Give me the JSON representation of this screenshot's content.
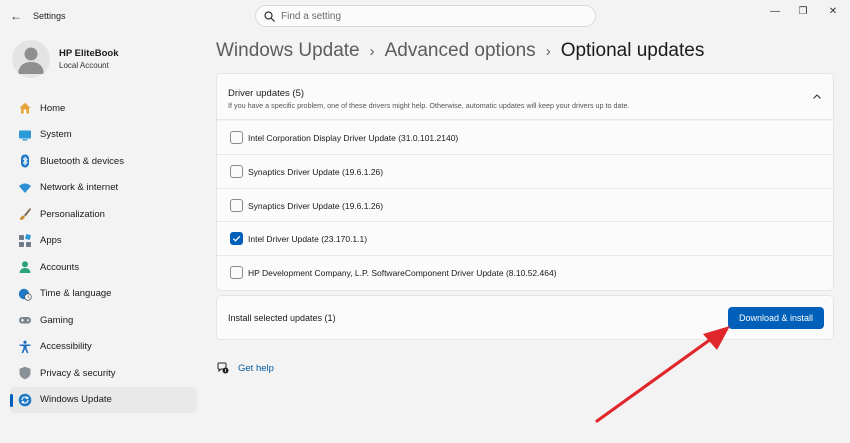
{
  "window": {
    "title": "Settings",
    "back_glyph": "←",
    "controls": [
      "—",
      "❐",
      "✕"
    ]
  },
  "search": {
    "placeholder": "Find a setting",
    "value": ""
  },
  "profile": {
    "name": "HP EliteBook",
    "account": "Local Account"
  },
  "nav": {
    "items": [
      {
        "label": "Home",
        "icon": "home-icon",
        "color": "#e8a33d"
      },
      {
        "label": "System",
        "icon": "system-icon",
        "color": "#2b9ad8"
      },
      {
        "label": "Bluetooth & devices",
        "icon": "bluetooth-icon",
        "color": "#1f79c7"
      },
      {
        "label": "Network & internet",
        "icon": "wifi-icon",
        "color": "#2f8fd6"
      },
      {
        "label": "Personalization",
        "icon": "brush-icon",
        "color": "#c98a35"
      },
      {
        "label": "Apps",
        "icon": "apps-icon",
        "color": "#6d7a85"
      },
      {
        "label": "Accounts",
        "icon": "accounts-icon",
        "color": "#2aa37a"
      },
      {
        "label": "Time & language",
        "icon": "globe-clock-icon",
        "color": "#1f79c7"
      },
      {
        "label": "Gaming",
        "icon": "gamepad-icon",
        "color": "#7b8790"
      },
      {
        "label": "Accessibility",
        "icon": "accessibility-icon",
        "color": "#1f6fc0"
      },
      {
        "label": "Privacy & security",
        "icon": "shield-icon",
        "color": "#8a9198"
      },
      {
        "label": "Windows Update",
        "icon": "sync-icon",
        "color": "#1f79c7",
        "active": true
      }
    ]
  },
  "breadcrumb": {
    "items": [
      "Windows Update",
      "Advanced options",
      "Optional updates"
    ],
    "separator": "›"
  },
  "drivers": {
    "title": "Driver updates (5)",
    "subtitle": "If you have a specific problem, one of these drivers might help. Otherwise, automatic updates will keep your drivers up to date.",
    "expanded": true,
    "items": [
      {
        "label": "Intel Corporation Display Driver Update (31.0.101.2140)",
        "checked": false
      },
      {
        "label": "Synaptics Driver Update (19.6.1.26)",
        "checked": false
      },
      {
        "label": "Synaptics Driver Update (19.6.1.26)",
        "checked": false
      },
      {
        "label": "Intel Driver Update (23.170.1.1)",
        "checked": true
      },
      {
        "label": "HP Development Company, L.P. SoftwareComponent Driver Update (8.10.52.464)",
        "checked": false
      }
    ]
  },
  "install": {
    "label": "Install selected updates (1)",
    "button": "Download & install"
  },
  "help": {
    "label": "Get help",
    "icon": "help-icon"
  },
  "colors": {
    "accent": "#005fb8",
    "annotation_arrow": "#e0282c"
  }
}
